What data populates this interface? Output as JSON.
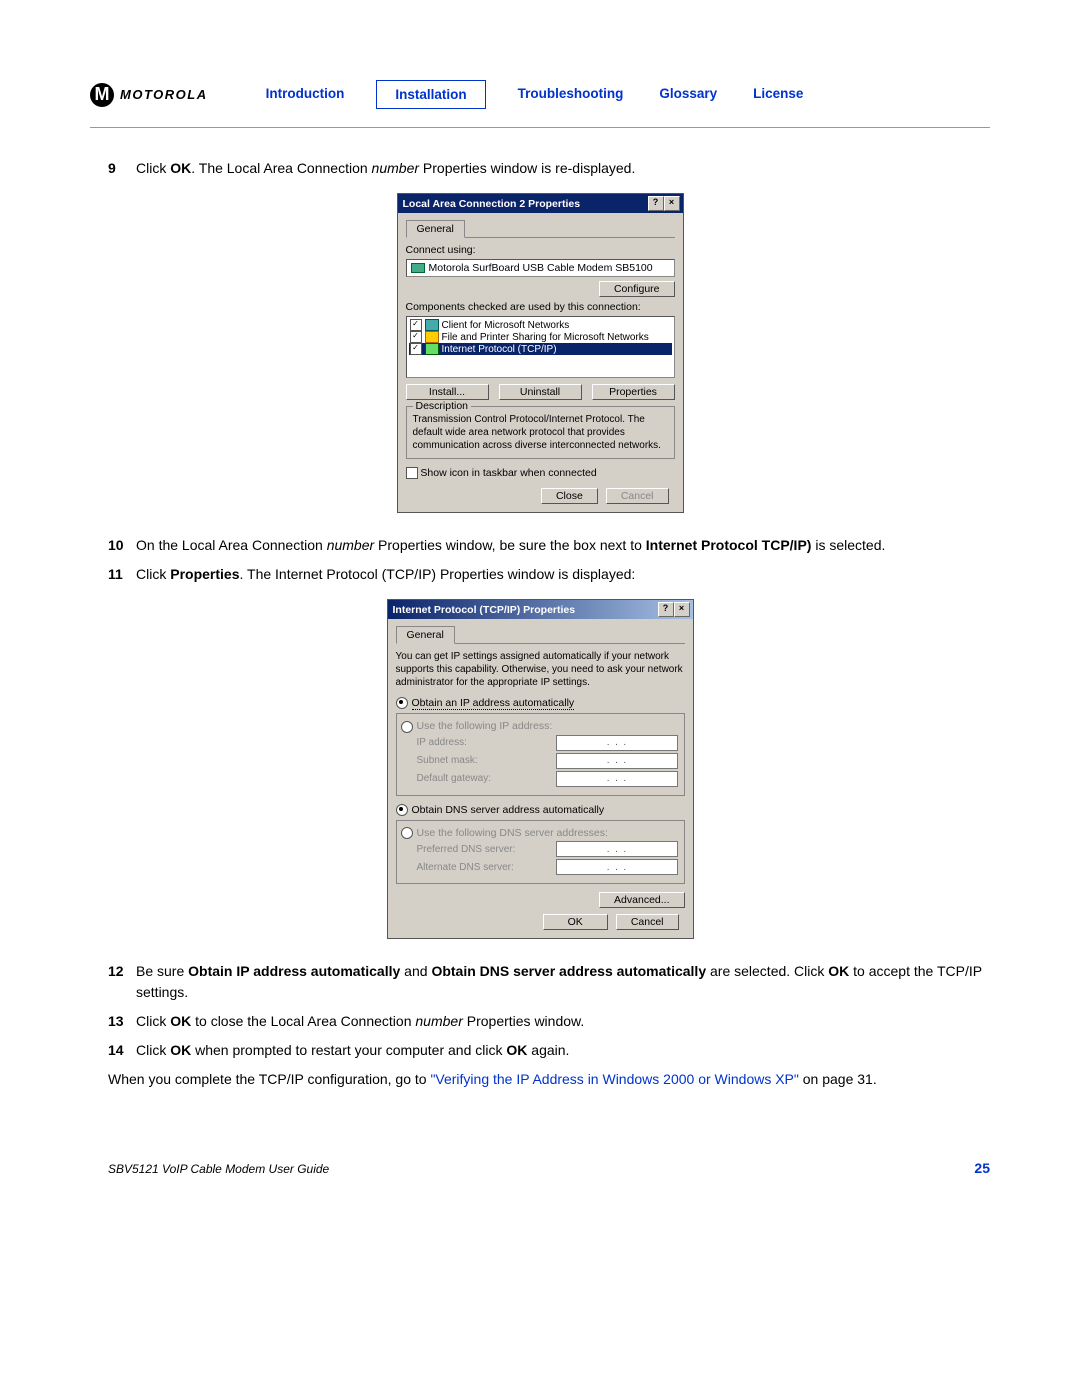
{
  "logo": {
    "m": "M",
    "text": "MOTOROLA"
  },
  "nav": {
    "introduction": "Introduction",
    "installation": "Installation",
    "troubleshooting": "Troubleshooting",
    "glossary": "Glossary",
    "license": "License"
  },
  "steps": {
    "s9": {
      "n": "9",
      "pre": "Click ",
      "b1": "OK",
      "post": ". The Local Area Connection ",
      "i": "number",
      "tail": " Properties window is re-displayed."
    },
    "s10": {
      "n": "10",
      "a": "On the Local Area Connection ",
      "i": "number",
      "b": " Properties window, be sure the box next to ",
      "bold": "Internet Protocol TCP/IP)",
      "c": " is selected."
    },
    "s11": {
      "n": "11",
      "a": "Click ",
      "b1": "Properties",
      "b": ". The Internet Protocol (TCP/IP) Properties window is displayed:"
    },
    "s12": {
      "n": "12",
      "a": "Be sure ",
      "b1": "Obtain IP address automatically",
      "b": " and ",
      "b2": "Obtain DNS server address automatically",
      "c": " are selected. Click ",
      "b3": "OK",
      "d": " to accept the TCP/IP settings."
    },
    "s13": {
      "n": "13",
      "a": "Click ",
      "b1": "OK",
      "b": " to close the Local Area Connection ",
      "i": "number",
      "c": " Properties window."
    },
    "s14": {
      "n": "14",
      "a": "Click ",
      "b1": "OK",
      "b": " when prompted to restart your computer and click ",
      "b2": "OK",
      "c": " again."
    }
  },
  "closing": {
    "a": "When you complete the TCP/IP configuration, go to ",
    "link": "\"Verifying the IP Address in Windows 2000 or Windows XP\"",
    "b": " on page 31."
  },
  "footer": {
    "guide": "SBV5121 VoIP Cable Modem User Guide",
    "page": "25"
  },
  "dlg1": {
    "title": "Local Area Connection 2 Properties",
    "help": "?",
    "close": "×",
    "tab": "General",
    "connect_using": "Connect using:",
    "adapter": "Motorola SurfBoard USB Cable Modem SB5100",
    "configure": "Configure",
    "components": "Components checked are used by this connection:",
    "item1": "Client for Microsoft Networks",
    "item2": "File and Printer Sharing for Microsoft Networks",
    "item3": "Internet Protocol (TCP/IP)",
    "install": "Install...",
    "uninstall": "Uninstall",
    "properties": "Properties",
    "desc_label": "Description",
    "desc": "Transmission Control Protocol/Internet Protocol. The default wide area network protocol that provides communication across diverse interconnected networks.",
    "showicon": "Show icon in taskbar when connected",
    "closebtn": "Close",
    "cancel": "Cancel"
  },
  "dlg2": {
    "title": "Internet Protocol (TCP/IP) Properties",
    "help": "?",
    "close": "×",
    "tab": "General",
    "intro": "You can get IP settings assigned automatically if your network supports this capability. Otherwise, you need to ask your network administrator for the appropriate IP settings.",
    "opt_auto_ip": "Obtain an IP address automatically",
    "opt_man_ip": "Use the following IP address:",
    "ip_addr": "IP address:",
    "subnet": "Subnet mask:",
    "gateway": "Default gateway:",
    "opt_auto_dns": "Obtain DNS server address automatically",
    "opt_man_dns": "Use the following DNS server addresses:",
    "pref_dns": "Preferred DNS server:",
    "alt_dns": "Alternate DNS server:",
    "advanced": "Advanced...",
    "ok": "OK",
    "cancel": "Cancel"
  }
}
